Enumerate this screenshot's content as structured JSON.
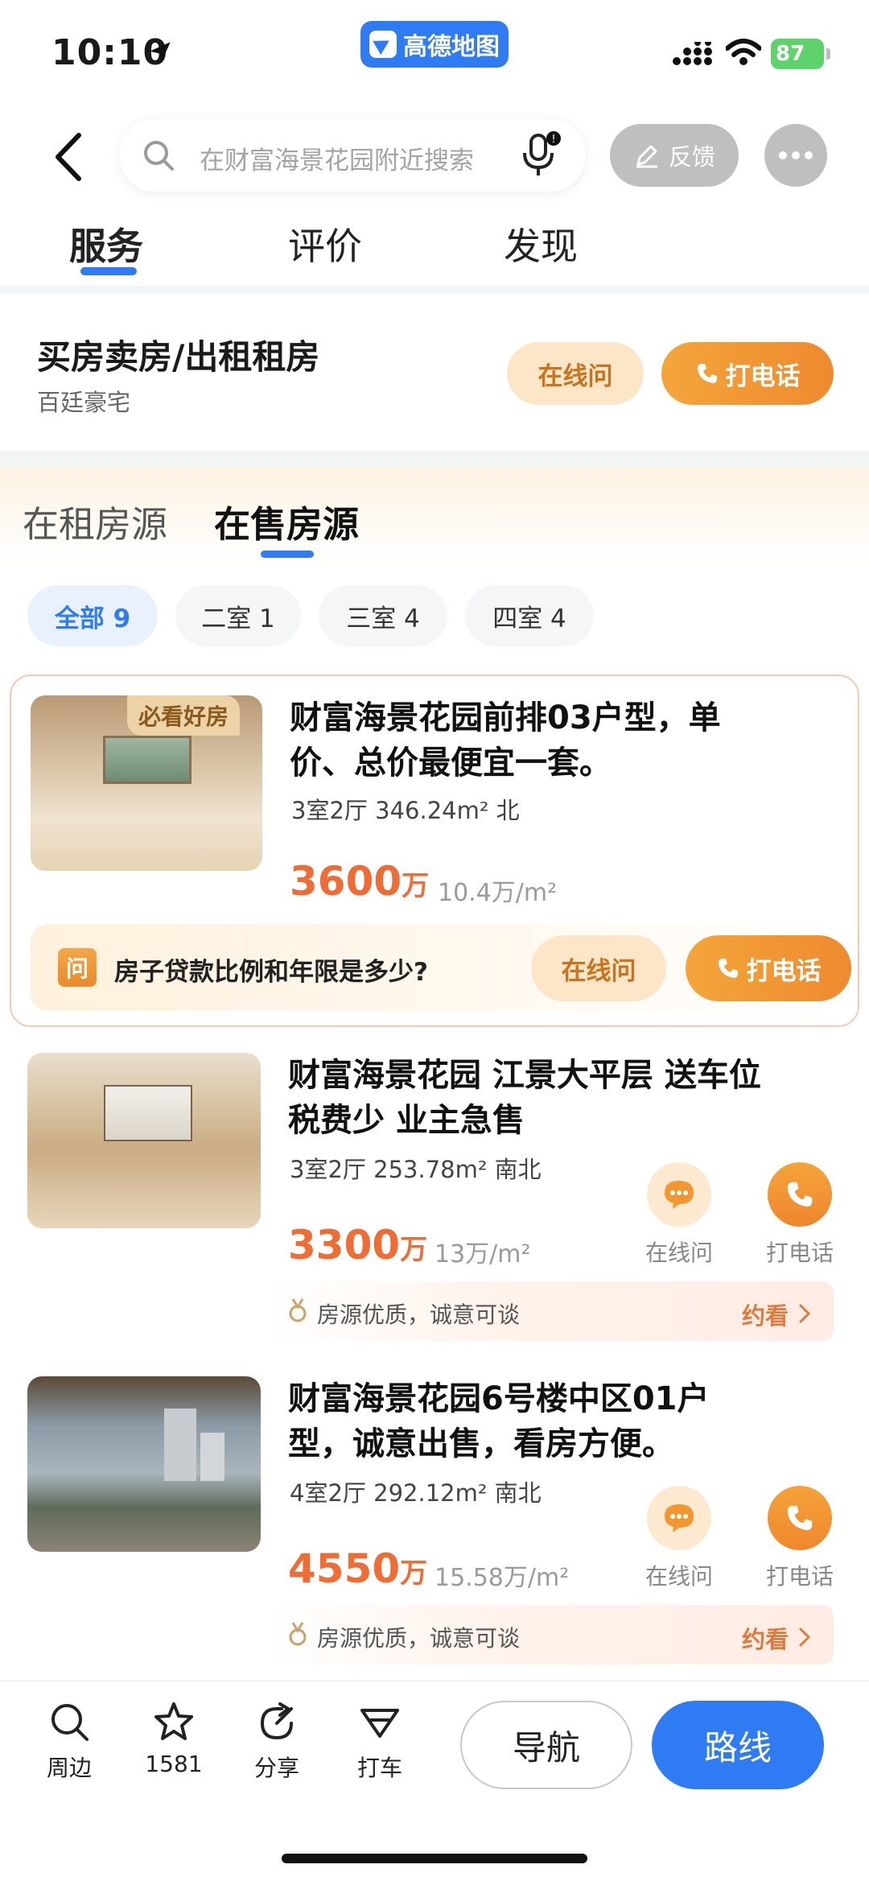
{
  "status_bar": {
    "time": "10:10",
    "app_name": "高德地图",
    "battery": "87"
  },
  "header": {
    "search_placeholder": "在财富海景花园附近搜索",
    "feedback_label": "反馈"
  },
  "main_tabs": [
    "服务",
    "评价",
    "发现"
  ],
  "service": {
    "title": "买房卖房/出租租房",
    "subtitle": "百廷豪宅",
    "online_label": "在线问",
    "call_label": "打电话"
  },
  "listing_tabs": [
    "在租房源",
    "在售房源"
  ],
  "filters": [
    "全部 9",
    "二室 1",
    "三室 4",
    "四室 4"
  ],
  "houses": [
    {
      "badge": "必看好房",
      "title_line1": "财富海景花园前排03户型，单",
      "title_line2": "价、总价最便宜一套。",
      "spec": "3室2厅 346.24m² 北",
      "price": "3600",
      "price_unit": "万",
      "unit_price": "10.4万/m²",
      "question": "房子贷款比例和年限是多少?",
      "q_icon": "问",
      "online_label": "在线问",
      "call_label": "打电话"
    },
    {
      "title_line1": "财富海景花园 江景大平层 送车位",
      "title_line2": "税费少 业主急售",
      "spec": "3室2厅 253.78m² 南北",
      "price": "3300",
      "price_unit": "万",
      "unit_price": "13万/m²",
      "online_label": "在线问",
      "call_label": "打电话",
      "promo": "房源优质，诚意可谈",
      "promo_link": "约看"
    },
    {
      "title_line1": "财富海景花园6号楼中区01户",
      "title_line2": "型，诚意出售，看房方便。",
      "spec": "4室2厅 292.12m² 南北",
      "price": "4550",
      "price_unit": "万",
      "unit_price": "15.58万/m²",
      "online_label": "在线问",
      "call_label": "打电话",
      "promo": "房源优质，诚意可谈",
      "promo_link": "约看"
    }
  ],
  "bottom_bar": {
    "items": [
      "周边",
      "1581",
      "分享",
      "打车"
    ],
    "nav_label": "导航",
    "route_label": "路线"
  },
  "colors": {
    "accent_blue": "#2f7bf3",
    "accent_orange": "#ef6c35",
    "call_orange": "#ee8a2f"
  }
}
